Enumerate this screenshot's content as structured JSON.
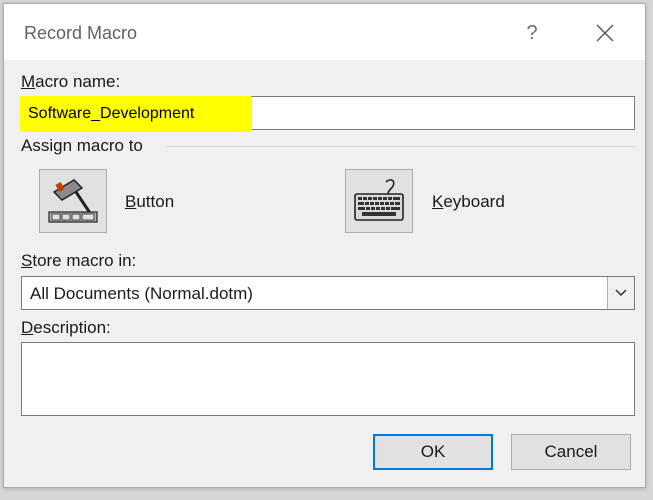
{
  "dialog": {
    "title": "Record Macro",
    "help_glyph": "?",
    "macro_name_label_key": "M",
    "macro_name_label_rest": "acro name:",
    "macro_name_value": "Software_Development",
    "assign_label": "Assign macro to",
    "button_option_key": "B",
    "button_option_rest": "utton",
    "keyboard_option_key": "K",
    "keyboard_option_rest": "eyboard",
    "store_label_key": "S",
    "store_label_rest": "tore macro in:",
    "store_value": "All Documents (Normal.dotm)",
    "description_label_key": "D",
    "description_label_rest": "escription:",
    "description_value": "",
    "ok_label": "OK",
    "cancel_label": "Cancel"
  },
  "colors": {
    "highlight": "#ffff00",
    "accent": "#0078d7"
  },
  "icons": [
    "help-icon",
    "close-icon",
    "hammer-icon",
    "keyboard-icon",
    "chevron-down-icon"
  ]
}
